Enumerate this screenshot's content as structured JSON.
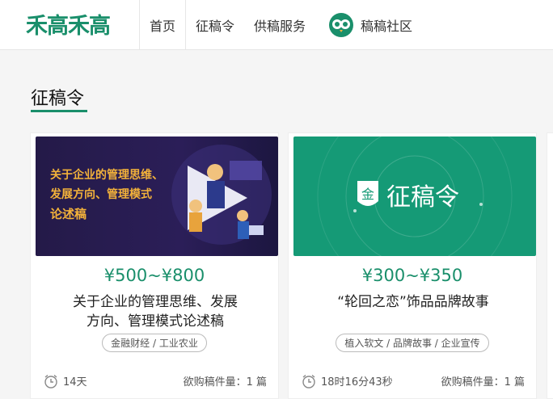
{
  "header": {
    "logo": "禾高禾高",
    "nav": [
      "首页",
      "征稿令",
      "供稿服务",
      "稿稿社区"
    ],
    "active": "首页"
  },
  "section": {
    "title": "征稿令"
  },
  "cards": [
    {
      "banner_text": [
        "关于企业的管理思维、",
        "发展方向、管理模式",
        "论述稿"
      ],
      "price": "¥500~¥800",
      "title_lines": [
        "关于企业的管理思维、发展",
        "方向、管理模式论述稿"
      ],
      "tags": "金融财经 / 工业农业",
      "time": "14天",
      "need": "欲购稿件量：1 篇"
    },
    {
      "banner_text": [
        "征稿令"
      ],
      "price": "¥300~¥350",
      "title_lines": [
        "“轮回之恋”饰品品牌故事"
      ],
      "tags": "植入软文 / 品牌故事 / 企业宣传",
      "time": "18时16分43秒",
      "need": "欲购稿件量：1 篇"
    }
  ],
  "colors": {
    "accent": "#1a8f6b",
    "banner_gold": "#f3b23a"
  },
  "icons": [
    "owl-logo-icon",
    "clock-icon",
    "seal-icon"
  ]
}
